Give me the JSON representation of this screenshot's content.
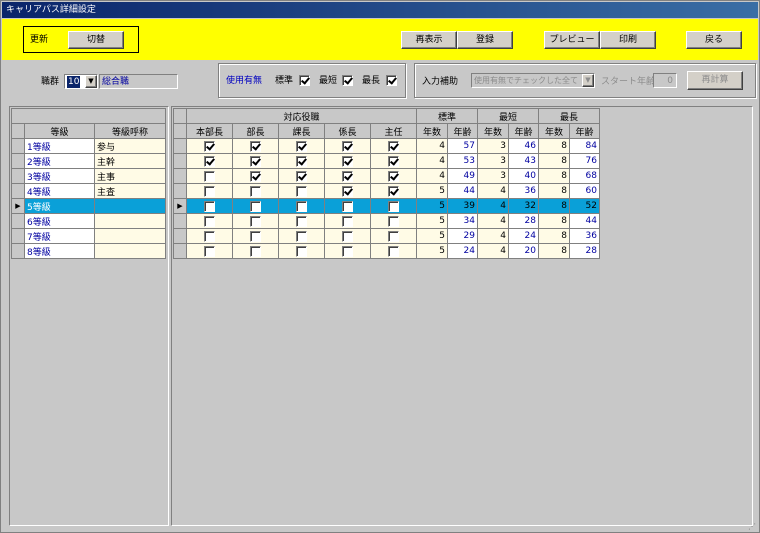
{
  "window": {
    "title": "キャリアパス詳細設定"
  },
  "toolbar": {
    "update_label": "更新",
    "switch_label": "切替",
    "redisplay_label": "再表示",
    "register_label": "登録",
    "preview_label": "プレビュー",
    "print_label": "印刷",
    "back_label": "戻る"
  },
  "filters": {
    "job_group_label": "職群",
    "job_group_code": "10",
    "job_group_name": "総合職",
    "usage_label": "使用有無",
    "standard_label": "標準",
    "standard_checked": true,
    "shortest_label": "最短",
    "shortest_checked": true,
    "longest_label": "最長",
    "longest_checked": true,
    "input_assist_label": "入力補助",
    "input_assist_value": "使用有無でチェックした全て",
    "start_age_label": "スタート年齢",
    "start_age_value": "0",
    "recalc_label": "再計算"
  },
  "grade_table": {
    "headers": {
      "grade": "等級",
      "grade_name": "等級呼称"
    },
    "rows": [
      {
        "code": "1等級",
        "name": "参与"
      },
      {
        "code": "2等級",
        "name": "主幹"
      },
      {
        "code": "3等級",
        "name": "主事"
      },
      {
        "code": "4等級",
        "name": "主査"
      },
      {
        "code": "5等級",
        "name": ""
      },
      {
        "code": "6等級",
        "name": ""
      },
      {
        "code": "7等級",
        "name": ""
      },
      {
        "code": "8等級",
        "name": ""
      }
    ]
  },
  "position_table": {
    "group_header": "対応役職",
    "positions": [
      "本部長",
      "部長",
      "課長",
      "係長",
      "主任"
    ],
    "standard_header": "標準",
    "shortest_header": "最短",
    "longest_header": "最長",
    "years_header": "年数",
    "age_header": "年齢",
    "rows": [
      {
        "checks": [
          true,
          true,
          true,
          true,
          true
        ],
        "std_years": "4",
        "std_age": "57",
        "short_years": "3",
        "short_age": "46",
        "long_years": "8",
        "long_age": "84"
      },
      {
        "checks": [
          true,
          true,
          true,
          true,
          true
        ],
        "std_years": "4",
        "std_age": "53",
        "short_years": "3",
        "short_age": "43",
        "long_years": "8",
        "long_age": "76"
      },
      {
        "checks": [
          false,
          true,
          true,
          true,
          true
        ],
        "std_years": "4",
        "std_age": "49",
        "short_years": "3",
        "short_age": "40",
        "long_years": "8",
        "long_age": "68"
      },
      {
        "checks": [
          false,
          false,
          false,
          true,
          true
        ],
        "std_years": "5",
        "std_age": "44",
        "short_years": "4",
        "short_age": "36",
        "long_years": "8",
        "long_age": "60"
      },
      {
        "checks": [
          false,
          false,
          false,
          false,
          false
        ],
        "std_years": "5",
        "std_age": "39",
        "short_years": "4",
        "short_age": "32",
        "long_years": "8",
        "long_age": "52"
      },
      {
        "checks": [
          false,
          false,
          false,
          false,
          false
        ],
        "std_years": "5",
        "std_age": "34",
        "short_years": "4",
        "short_age": "28",
        "long_years": "8",
        "long_age": "44"
      },
      {
        "checks": [
          false,
          false,
          false,
          false,
          false
        ],
        "std_years": "5",
        "std_age": "29",
        "short_years": "4",
        "short_age": "24",
        "long_years": "8",
        "long_age": "36"
      },
      {
        "checks": [
          false,
          false,
          false,
          false,
          false
        ],
        "std_years": "5",
        "std_age": "24",
        "short_years": "4",
        "short_age": "20",
        "long_years": "8",
        "long_age": "28"
      }
    ],
    "current_row": 4
  },
  "colors": {
    "toolbar_bg": "#ffff00",
    "selected_row": "#0aa0d8",
    "titlebar": "#0a246a"
  }
}
